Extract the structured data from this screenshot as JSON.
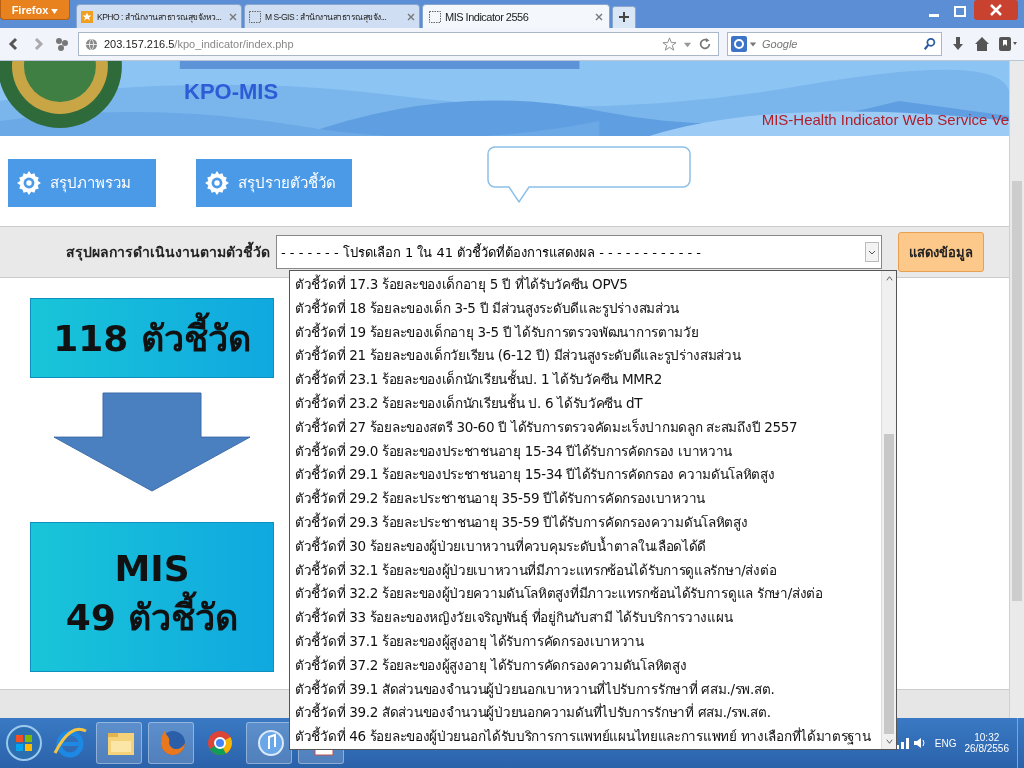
{
  "browser": {
    "menu_button": "Firefox",
    "tabs": [
      {
        "label": "KPHO : สำนักงานสาธารณสุขจังหว...",
        "selected": false
      },
      {
        "label": "M S-GIS : สำนักงานสาธารณสุขจัง...",
        "selected": false
      },
      {
        "label": "MIS Indicator 2556",
        "selected": true
      }
    ],
    "address_host": "203.157.216.5",
    "address_path": "/kpo_indicator/index.php",
    "search_placeholder": "Google"
  },
  "banner": {
    "logo_text": "KPO-MIS",
    "tagline": "MIS-Health Indicator Web Service Ve"
  },
  "nav_buttons": [
    "สรุปภาพรวม",
    "สรุปรายตัวชี้วัด"
  ],
  "filter": {
    "label": "สรุปผลการดำเนินงานตามตัวชี้วัด",
    "select_value": "- - - - - - - โปรดเลือก 1 ใน 41 ตัวชี้วัดที่ต้องการแสดงผล - - - - - - - - - - - -",
    "button": "แสดงข้อมูล"
  },
  "dropdown_options": [
    "ตัวชี้วัดที่ 17.3 ร้อยละของเด็กอายุ 5 ปี ที่ได้รับวัคซีน OPV5",
    "ตัวชี้วัดที่ 18 ร้อยละของเด็ก 3-5 ปี มีส่วนสูงระดับดีและรูปร่างสมส่วน",
    "ตัวชี้วัดที่ 19 ร้อยละของเด็กอายุ 3-5 ปี ได้รับการตรวจพัฒนาการตามวัย",
    "ตัวชี้วัดที่ 21 ร้อยละของเด็กวัยเรียน (6-12 ปี) มีส่วนสูงระดับดีและรูปร่างสมส่วน",
    "ตัวชี้วัดที่ 23.1 ร้อยละของเด็กนักเรียนชั้นป. 1 ได้รับวัคซีน MMR2",
    "ตัวชี้วัดที่ 23.2 ร้อยละของเด็กนักเรียนชั้น ป. 6 ได้รับวัคซีน dT",
    "ตัวชี้วัดที่ 27 ร้อยละของสตรี 30-60 ปี ได้รับการตรวจคัดมะเร็งปากมดลูก สะสมถึงปี 2557",
    "ตัวชี้วัดที่ 29.0 ร้อยละของประชาชนอายุ 15-34 ปีได้รับการคัดกรอง เบาหวาน",
    "ตัวชี้วัดที่ 29.1 ร้อยละของประชาชนอายุ 15-34 ปีได้รับการคัดกรอง ความดันโลหิตสูง",
    "ตัวชี้วัดที่ 29.2 ร้อยละประชาชนอายุ 35-59 ปีได้รับการคัดกรองเบาหวาน",
    "ตัวชี้วัดที่ 29.3 ร้อยละประชาชนอายุ 35-59 ปีได้รับการคัดกรองความดันโลหิตสูง",
    "ตัวชี้วัดที่ 30 ร้อยละของผู้ป่วยเบาหวานที่ควบคุมระดับน้ำตาลในเลือดได้ดี",
    "ตัวชี้วัดที่ 32.1 ร้อยละของผู้ป่วยเบาหวานที่มีภาวะแทรกซ้อนได้รับการดูแลรักษา/ส่งต่อ",
    "ตัวชี้วัดที่ 32.2 ร้อยละของผู้ป่วยความดันโลหิตสูงที่มีภาวะแทรกซ้อนได้รับการดูแล รักษา/ส่งต่อ",
    "ตัวชี้วัดที่ 33 ร้อยละของหญิงวัยเจริญพันธุ์ ที่อยู่กินกับสามี ได้รับบริการวางแผน",
    "ตัวชี้วัดที่ 37.1 ร้อยละของผู้สูงอายุ ได้รับการคัดกรองเบาหวาน",
    "ตัวชี้วัดที่ 37.2 ร้อยละของผู้สูงอายุ ได้รับการคัดกรองความดันโลหิตสูง",
    "ตัวชี้วัดที่ 39.1 สัดส่วนของจำนวนผู้ป่วยนอกเบาหวานที่ไปรับการรักษาที่ ศสม./รพ.สต.",
    "ตัวชี้วัดที่ 39.2 สัดส่วนของจำนวนผู้ป่วยนอกความดันที่ไปรับการรักษาที่ ศสม./รพ.สต.",
    "ตัวชี้วัดที่ 46 ร้อยละของผู้ป่วยนอกได้รับบริการการแพทย์แผนไทยและการแพทย์ ทางเลือกที่ได้มาตรฐาน"
  ],
  "summary": {
    "total": "118 ตัวชี้วัด",
    "mis_title": "MIS",
    "mis_count": "49 ตัวชี้วัด"
  },
  "taskbar": {
    "language": "ENG",
    "time": "10:32",
    "date": "26/8/2556"
  }
}
